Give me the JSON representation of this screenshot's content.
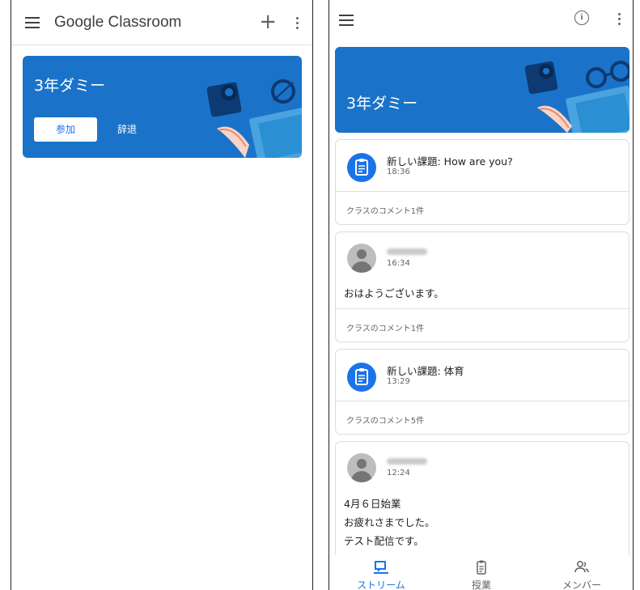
{
  "left_screen": {
    "app_title": "Google Classroom",
    "add_icon": "plus-icon",
    "menu_icon": "hamburger-menu-icon",
    "more_icon": "more-vert-icon",
    "class_card": {
      "name": "3年ダミー",
      "join_label": "参加",
      "decline_label": "辞退"
    }
  },
  "right_screen": {
    "menu_icon": "hamburger-menu-icon",
    "info_icon": "info-icon",
    "more_icon": "more-vert-icon",
    "info_glyph": "i",
    "class_name": "3年ダミー",
    "posts": [
      {
        "type": "assignment",
        "title": "新しい課題: How are you?",
        "time": "18:36",
        "comments": "クラスのコメント1件"
      },
      {
        "type": "announcement",
        "time": "16:34",
        "body": [
          "おはようございます。"
        ],
        "comments": "クラスのコメント1件"
      },
      {
        "type": "assignment",
        "title": "新しい課題: 体育",
        "time": "13:29",
        "comments": "クラスのコメント5件"
      },
      {
        "type": "announcement",
        "time": "12:24",
        "body": [
          "4月６日始業",
          "お疲れさまでした。",
          "テスト配信です。"
        ]
      }
    ],
    "bottom_nav": [
      {
        "label": "ストリーム",
        "icon": "stream-icon",
        "active": true
      },
      {
        "label": "授業",
        "icon": "classwork-icon",
        "active": false
      },
      {
        "label": "メンバー",
        "icon": "people-icon",
        "active": false
      }
    ]
  },
  "colors": {
    "accent": "#1a73e8",
    "banner": "#1a73c8"
  }
}
